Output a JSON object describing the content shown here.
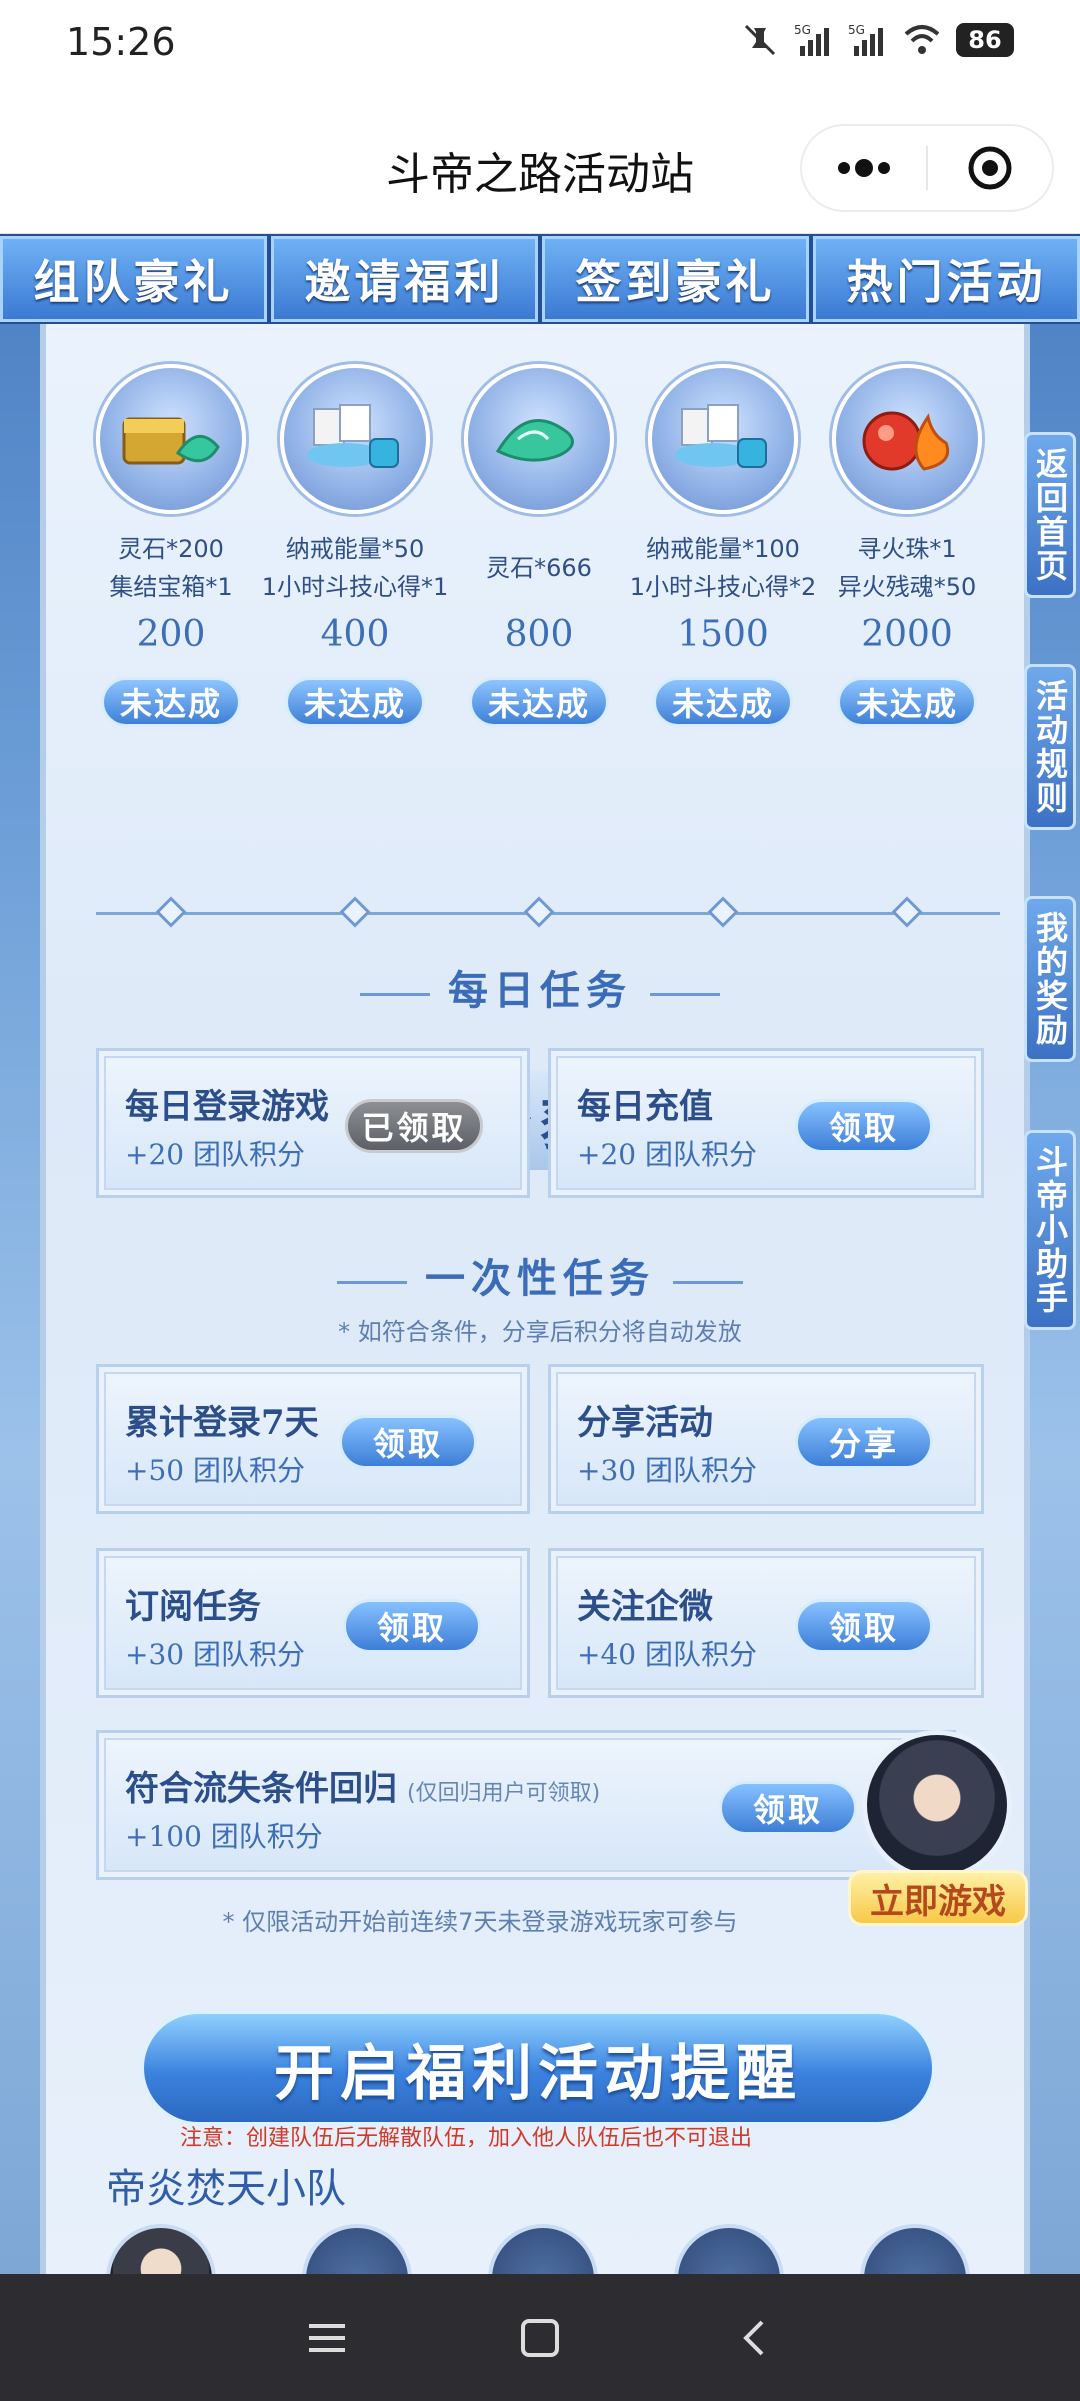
{
  "status_bar": {
    "time": "15:26",
    "battery": "86"
  },
  "app": {
    "title": "斗帝之路活动站"
  },
  "tabs": [
    {
      "label": "组队豪礼"
    },
    {
      "label": "邀请福利"
    },
    {
      "label": "签到豪礼"
    },
    {
      "label": "热门活动"
    }
  ],
  "rewards": [
    {
      "name": "灵石*200\n集结宝箱*1",
      "points": "200",
      "status": "未达成"
    },
    {
      "name": "纳戒能量*50\n1小时斗技心得*1",
      "points": "400",
      "status": "未达成"
    },
    {
      "name": "灵石*666",
      "points": "800",
      "status": "未达成"
    },
    {
      "name": "纳戒能量*100\n1小时斗技心得*2",
      "points": "1500",
      "status": "未达成"
    },
    {
      "name": "寻火珠*1\n异火残魂*50",
      "points": "2000",
      "status": "未达成"
    }
  ],
  "section": {
    "title": "积分获取",
    "daily_title": "每日任务",
    "once_title": "一次性任务",
    "once_note": "* 如符合条件，分享后积分将自动发放",
    "return_note": "* 仅限活动开始前连续7天未登录游戏玩家可参与"
  },
  "daily_tasks": [
    {
      "title": "每日登录游戏",
      "reward": "+20 团队积分",
      "button": "已领取"
    },
    {
      "title": "每日充值",
      "reward": "+20 团队积分",
      "button": "领取"
    }
  ],
  "once_tasks": [
    {
      "title": "累计登录7天",
      "reward": "+50 团队积分",
      "button": "领取"
    },
    {
      "title": "分享活动",
      "reward": "+30 团队积分",
      "button": "分享"
    },
    {
      "title": "订阅任务",
      "reward": "+30 团队积分",
      "button": "领取"
    },
    {
      "title": "关注企微",
      "reward": "+40 团队积分",
      "button": "领取"
    }
  ],
  "return_task": {
    "title": "符合流失条件回归",
    "hint": "(仅回归用户可领取)",
    "reward": "+100 团队积分",
    "button": "领取"
  },
  "hero": {
    "play_label": "立即游戏"
  },
  "side_tabs": [
    "返回首页",
    "活动规则",
    "我的奖励",
    "斗帝小助手"
  ],
  "reminder_button": "开启福利活动提醒",
  "warning": "注意：创建队伍后无解散队伍，加入他人队伍后也不可退出",
  "team_name": "帝炎焚天小队"
}
